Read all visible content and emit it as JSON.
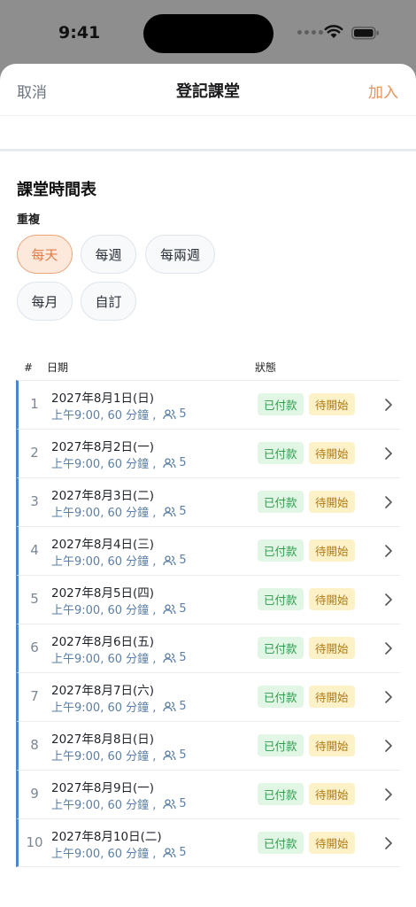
{
  "status_bar": {
    "time": "9:41"
  },
  "nav": {
    "cancel_label": "取消",
    "title": "登記課堂",
    "add_label": "加入"
  },
  "schedule": {
    "title": "課堂時間表",
    "repeat_label": "重複",
    "repeat_options": [
      {
        "label": "每天",
        "selected": true
      },
      {
        "label": "每週",
        "selected": false
      },
      {
        "label": "每兩週",
        "selected": false
      },
      {
        "label": "每月",
        "selected": false
      },
      {
        "label": "自訂",
        "selected": false
      }
    ]
  },
  "table": {
    "headers": {
      "number": "#",
      "date": "日期",
      "status": "狀態"
    },
    "rows": [
      {
        "num": "1",
        "date": "2027年8月1日(日)",
        "time": "上午9:00, 60 分鐘 ,",
        "people": "5",
        "paid": "已付款",
        "pending": "待開始"
      },
      {
        "num": "2",
        "date": "2027年8月2日(一)",
        "time": "上午9:00, 60 分鐘 ,",
        "people": "5",
        "paid": "已付款",
        "pending": "待開始"
      },
      {
        "num": "3",
        "date": "2027年8月3日(二)",
        "time": "上午9:00, 60 分鐘 ,",
        "people": "5",
        "paid": "已付款",
        "pending": "待開始"
      },
      {
        "num": "4",
        "date": "2027年8月4日(三)",
        "time": "上午9:00, 60 分鐘 ,",
        "people": "5",
        "paid": "已付款",
        "pending": "待開始"
      },
      {
        "num": "5",
        "date": "2027年8月5日(四)",
        "time": "上午9:00, 60 分鐘 ,",
        "people": "5",
        "paid": "已付款",
        "pending": "待開始"
      },
      {
        "num": "6",
        "date": "2027年8月6日(五)",
        "time": "上午9:00, 60 分鐘 ,",
        "people": "5",
        "paid": "已付款",
        "pending": "待開始"
      },
      {
        "num": "7",
        "date": "2027年8月7日(六)",
        "time": "上午9:00, 60 分鐘 ,",
        "people": "5",
        "paid": "已付款",
        "pending": "待開始"
      },
      {
        "num": "8",
        "date": "2027年8月8日(日)",
        "time": "上午9:00, 60 分鐘 ,",
        "people": "5",
        "paid": "已付款",
        "pending": "待開始"
      },
      {
        "num": "9",
        "date": "2027年8月9日(一)",
        "time": "上午9:00, 60 分鐘 ,",
        "people": "5",
        "paid": "已付款",
        "pending": "待開始"
      },
      {
        "num": "10",
        "date": "2027年8月10日(二)",
        "time": "上午9:00, 60 分鐘 ,",
        "people": "5",
        "paid": "已付款",
        "pending": "待開始"
      }
    ]
  },
  "colors": {
    "accent": "#e8935a",
    "row_indicator": "#4a86d4",
    "paid_bg": "#e1f6e5",
    "pending_bg": "#fdf1c8"
  }
}
